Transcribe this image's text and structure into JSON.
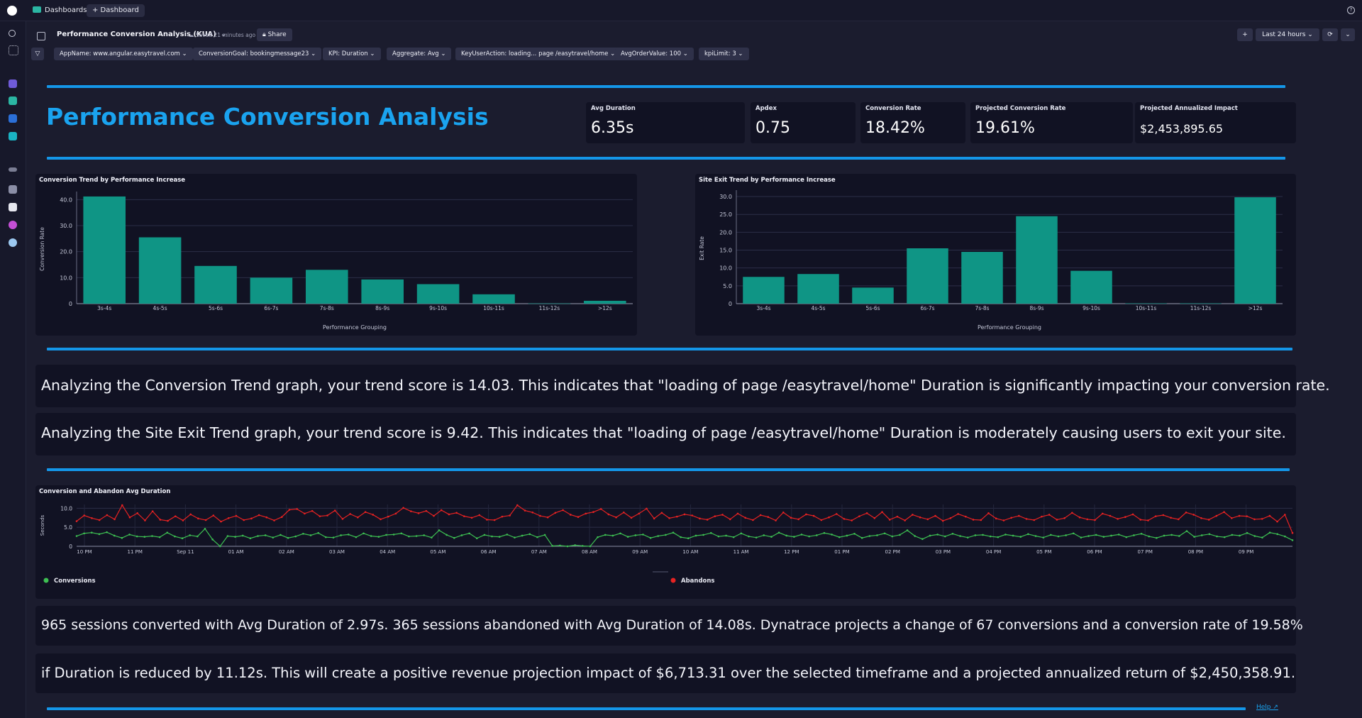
{
  "topbar": {
    "tab_dashboards": "Dashboards",
    "tab_add": "+ Dashboard"
  },
  "header": {
    "title": "Performance Conversion Analysis (KUA)",
    "saved": "Saved 21 minutes ago",
    "share": "Share",
    "add": "+",
    "timeframe": "Last 24 hours",
    "refresh": "⟳",
    "more": "⌄"
  },
  "filters": [
    "AppName: www.angular.easytravel.com",
    "ConversionGoal: bookingmessage23",
    "KPI: Duration",
    "Aggregate: Avg",
    "KeyUserAction: loading... page /easytravel/home",
    "AvgOrderValue: 100",
    "kpiLimit: 3"
  ],
  "page_title": "Performance Conversion Analysis",
  "kpis": [
    {
      "label": "Avg Duration",
      "value": "6.35s"
    },
    {
      "label": "Apdex",
      "value": "0.75"
    },
    {
      "label": "Conversion Rate",
      "value": "18.42%"
    },
    {
      "label": "Projected Conversion Rate",
      "value": "19.61%"
    },
    {
      "label": "Projected Annualized Impact",
      "value": "$2,453,895.65"
    }
  ],
  "analysis_text": [
    "Analyzing the Conversion Trend graph, your trend score is 14.03. This indicates that \"loading of page /easytravel/home\" Duration is significantly impacting your conversion rate.",
    "Analyzing the Site Exit Trend graph, your trend score is 9.42. This indicates that \"loading of page /easytravel/home\" Duration is moderately causing users to exit your site."
  ],
  "summary_text": [
    "965 sessions converted with Avg Duration of 2.97s. 365 sessions abandoned with Avg Duration of 14.08s. Dynatrace projects a change of 67 conversions and a conversion rate of 19.58%",
    "if Duration is reduced by 11.12s. This will create a positive revenue projection impact of $6,713.31 over the selected timeframe and a projected annualized return of $2,450,358.91."
  ],
  "help": "Help",
  "colors": {
    "accent": "#1496e8",
    "bar": "#0f9585",
    "conversions": "#3dbf52",
    "abandons": "#e62222"
  },
  "chart_data": [
    {
      "type": "bar",
      "title": "Conversion Trend by Performance Increase",
      "xlabel": "Performance Grouping",
      "ylabel": "Conversion Rate",
      "ylim": [
        0,
        42
      ],
      "yticks": [
        0,
        10,
        20,
        30,
        40
      ],
      "ytick_labels": [
        "0",
        "10.0",
        "20.0",
        "30.0",
        "40.0"
      ],
      "categories": [
        "3s-4s",
        "4s-5s",
        "5s-6s",
        "6s-7s",
        "7s-8s",
        "8s-9s",
        "9s-10s",
        "10s-11s",
        "11s-12s",
        ">12s"
      ],
      "values": [
        41.2,
        25.5,
        14.5,
        10.0,
        13.0,
        9.3,
        7.5,
        3.6,
        0.1,
        1.1
      ]
    },
    {
      "type": "bar",
      "title": "Site Exit Trend by Performance Increase",
      "xlabel": "Performance Grouping",
      "ylabel": "Exit Rate",
      "ylim": [
        0,
        31
      ],
      "yticks": [
        0,
        5,
        10,
        15,
        20,
        25,
        30
      ],
      "ytick_labels": [
        "0",
        "5.0",
        "10.0",
        "15.0",
        "20.0",
        "25.0",
        "30.0"
      ],
      "categories": [
        "3s-4s",
        "4s-5s",
        "5s-6s",
        "6s-7s",
        "7s-8s",
        "8s-9s",
        "9s-10s",
        "10s-11s",
        "11s-12s",
        ">12s"
      ],
      "values": [
        7.5,
        8.3,
        4.5,
        15.5,
        14.5,
        24.5,
        9.2,
        0.1,
        0.1,
        29.8
      ]
    },
    {
      "type": "line",
      "title": "Conversion and Abandon Avg Duration",
      "ylabel": "Seconds",
      "ylim": [
        0,
        11
      ],
      "yticks": [
        0,
        5,
        10
      ],
      "ytick_labels": [
        "0",
        "5.0",
        "10.0"
      ],
      "x_labels": [
        "10 PM",
        "11 PM",
        "Sep 11",
        "01 AM",
        "02 AM",
        "03 AM",
        "04 AM",
        "05 AM",
        "06 AM",
        "07 AM",
        "08 AM",
        "09 AM",
        "10 AM",
        "11 AM",
        "12 PM",
        "01 PM",
        "02 PM",
        "03 PM",
        "04 PM",
        "05 PM",
        "06 PM",
        "07 PM",
        "08 PM",
        "09 PM"
      ],
      "legend": "bottom",
      "series": [
        {
          "name": "Conversions",
          "values": [
            2.7,
            3.4,
            3.6,
            3.2,
            3.7,
            2.8,
            2.2,
            3.1,
            2.6,
            2.5,
            2.7,
            2.4,
            3.6,
            2.6,
            2.1,
            2.9,
            2.6,
            4.6,
            1.8,
            0.0,
            2.7,
            2.5,
            2.8,
            2.1,
            2.7,
            2.9,
            2.3,
            3.0,
            2.2,
            2.6,
            3.3,
            2.9,
            3.5,
            2.4,
            2.3,
            2.9,
            3.1,
            2.4,
            3.4,
            2.7,
            2.5,
            3.0,
            3.1,
            3.4,
            2.6,
            2.7,
            2.9,
            2.3,
            4.2,
            3.0,
            2.2,
            2.9,
            3.4,
            2.1,
            3.0,
            2.6,
            2.5,
            3.1,
            2.3,
            2.8,
            3.2,
            2.4,
            3.0,
            0.1,
            0.2,
            0.0,
            0.3,
            0.1,
            0.0,
            2.4,
            3.0,
            2.8,
            3.4,
            2.5,
            2.9,
            3.1,
            2.2,
            2.7,
            3.0,
            3.6,
            2.4,
            2.1,
            2.8,
            3.0,
            3.5,
            2.6,
            2.8,
            2.4,
            3.4,
            2.6,
            2.3,
            2.9,
            2.5,
            3.6,
            2.8,
            2.5,
            3.1,
            2.6,
            2.9,
            3.5,
            3.1,
            2.4,
            2.8,
            3.3,
            2.2,
            2.7,
            2.9,
            3.4,
            2.6,
            3.0,
            4.2,
            2.7,
            1.9,
            2.8,
            3.1,
            2.6,
            3.3,
            2.7,
            2.3,
            2.9,
            3.0,
            2.6,
            2.4,
            3.1,
            2.8,
            2.5,
            3.2,
            2.7,
            2.3,
            3.0,
            2.6,
            2.9,
            3.4,
            2.3,
            2.7,
            3.0,
            2.5,
            2.8,
            3.1,
            2.4,
            2.9,
            3.3,
            2.6,
            2.2,
            2.8,
            3.0,
            2.7,
            4.0,
            2.5,
            2.9,
            3.2,
            2.6,
            2.4,
            3.0,
            2.8,
            3.5,
            2.7,
            2.3,
            3.6,
            3.2,
            2.6,
            1.6
          ]
        },
        {
          "name": "Abandons",
          "values": [
            6.6,
            8.1,
            7.4,
            6.9,
            8.2,
            7.1,
            10.8,
            7.6,
            8.7,
            6.8,
            9.2,
            7.0,
            6.7,
            7.9,
            6.8,
            8.4,
            7.3,
            6.9,
            8.1,
            6.5,
            7.4,
            8.0,
            6.9,
            7.3,
            8.2,
            7.6,
            6.8,
            7.7,
            9.6,
            9.8,
            8.6,
            9.3,
            7.9,
            8.1,
            9.4,
            7.2,
            8.5,
            7.6,
            9.0,
            8.3,
            7.1,
            7.8,
            8.6,
            10.1,
            9.2,
            8.7,
            9.3,
            8.0,
            9.5,
            8.4,
            8.8,
            7.9,
            7.5,
            8.2,
            7.0,
            6.9,
            7.8,
            8.1,
            10.8,
            9.4,
            8.9,
            8.0,
            7.6,
            8.8,
            9.5,
            8.3,
            7.7,
            8.6,
            9.0,
            9.8,
            8.4,
            7.6,
            8.9,
            7.5,
            8.6,
            9.9,
            7.3,
            8.8,
            7.4,
            7.8,
            8.4,
            8.1,
            7.3,
            7.0,
            7.9,
            8.3,
            7.1,
            8.6,
            7.5,
            6.9,
            8.2,
            7.7,
            6.8,
            8.9,
            7.5,
            7.1,
            8.4,
            8.0,
            6.9,
            7.6,
            8.5,
            7.2,
            6.8,
            7.9,
            8.7,
            7.4,
            9.0,
            7.0,
            7.8,
            6.8,
            8.3,
            7.6,
            7.1,
            8.0,
            6.7,
            7.4,
            8.5,
            7.8,
            7.0,
            6.9,
            8.7,
            7.3,
            6.8,
            7.5,
            8.0,
            7.2,
            6.9,
            7.8,
            8.3,
            7.0,
            7.4,
            8.8,
            7.6,
            7.1,
            6.9,
            8.6,
            8.0,
            7.2,
            7.7,
            8.4,
            7.0,
            6.8,
            7.9,
            8.2,
            7.5,
            7.1,
            8.9,
            8.3,
            7.4,
            7.0,
            8.0,
            9.0,
            7.4,
            8.0,
            7.9,
            7.1,
            7.2,
            8.0,
            6.5,
            8.3,
            3.5
          ]
        }
      ]
    }
  ]
}
